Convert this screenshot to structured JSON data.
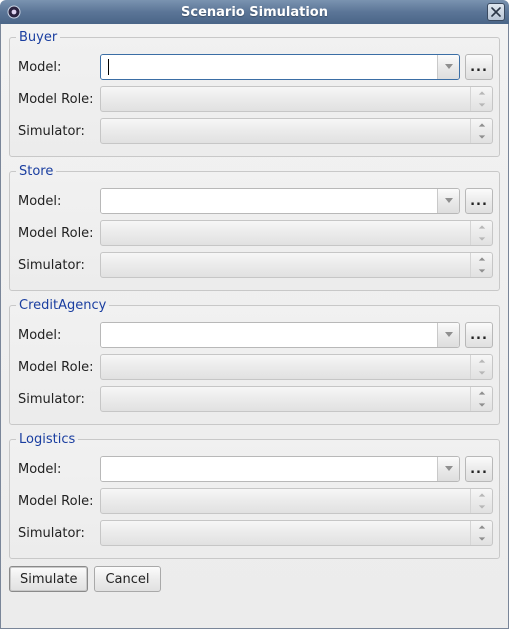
{
  "window": {
    "title": "Scenario Simulation",
    "close_tooltip": "Close"
  },
  "groups": [
    {
      "legend": "Buyer",
      "model_label": "Model:",
      "model_value": "",
      "model_focused": true,
      "role_label": "Model Role:",
      "role_value": "",
      "sim_label": "Simulator:",
      "sim_value": "",
      "browse_label": "..."
    },
    {
      "legend": "Store",
      "model_label": "Model:",
      "model_value": "",
      "model_focused": false,
      "role_label": "Model Role:",
      "role_value": "",
      "sim_label": "Simulator:",
      "sim_value": "",
      "browse_label": "..."
    },
    {
      "legend": "CreditAgency",
      "model_label": "Model:",
      "model_value": "",
      "model_focused": false,
      "role_label": "Model Role:",
      "role_value": "",
      "sim_label": "Simulator:",
      "sim_value": "",
      "browse_label": "..."
    },
    {
      "legend": "Logistics",
      "model_label": "Model:",
      "model_value": "",
      "model_focused": false,
      "role_label": "Model Role:",
      "role_value": "",
      "sim_label": "Simulator:",
      "sim_value": "",
      "browse_label": "..."
    }
  ],
  "buttons": {
    "simulate": "Simulate",
    "cancel": "Cancel"
  }
}
